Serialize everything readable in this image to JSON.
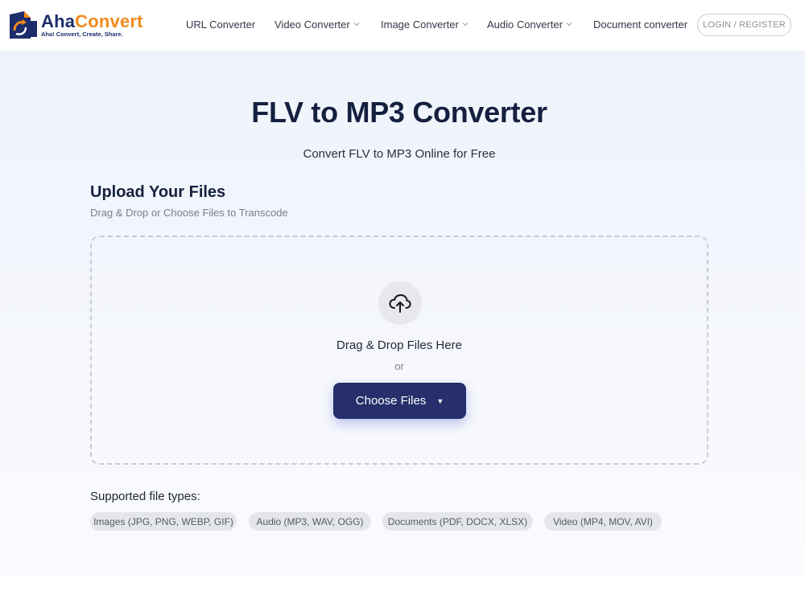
{
  "brand": {
    "name_part1": "Aha",
    "name_part2": "Convert",
    "tagline": "Aha! Convert, Create, Share.",
    "colors": {
      "navy": "#1d2d6b",
      "orange": "#f08a1c"
    }
  },
  "nav": {
    "items": [
      {
        "label": "URL Converter",
        "has_dropdown": false
      },
      {
        "label": "Video Converter",
        "has_dropdown": true
      },
      {
        "label": "Image Converter",
        "has_dropdown": true
      },
      {
        "label": "Audio Converter",
        "has_dropdown": true
      },
      {
        "label": "Document converter",
        "has_dropdown": false
      }
    ],
    "login_label": "LOGIN / REGISTER"
  },
  "hero": {
    "title": "FLV to MP3 Converter",
    "subtitle": "Convert FLV to MP3 Online for Free"
  },
  "upload": {
    "title": "Upload Your Files",
    "subtitle": "Drag & Drop or Choose Files to Transcode",
    "icon": "cloud-upload-icon",
    "drop_text": "Drag & Drop Files Here",
    "or_text": "or",
    "choose_label": "Choose Files",
    "choose_caret": "▼",
    "button_color": "#262f6b"
  },
  "supported": {
    "label": "Supported file types:",
    "types": [
      "Images (JPG, PNG, WEBP, GIF)",
      "Audio (MP3, WAV, OGG)",
      "Documents (PDF, DOCX, XLSX)",
      "Video (MP4, MOV, AVI)"
    ]
  }
}
